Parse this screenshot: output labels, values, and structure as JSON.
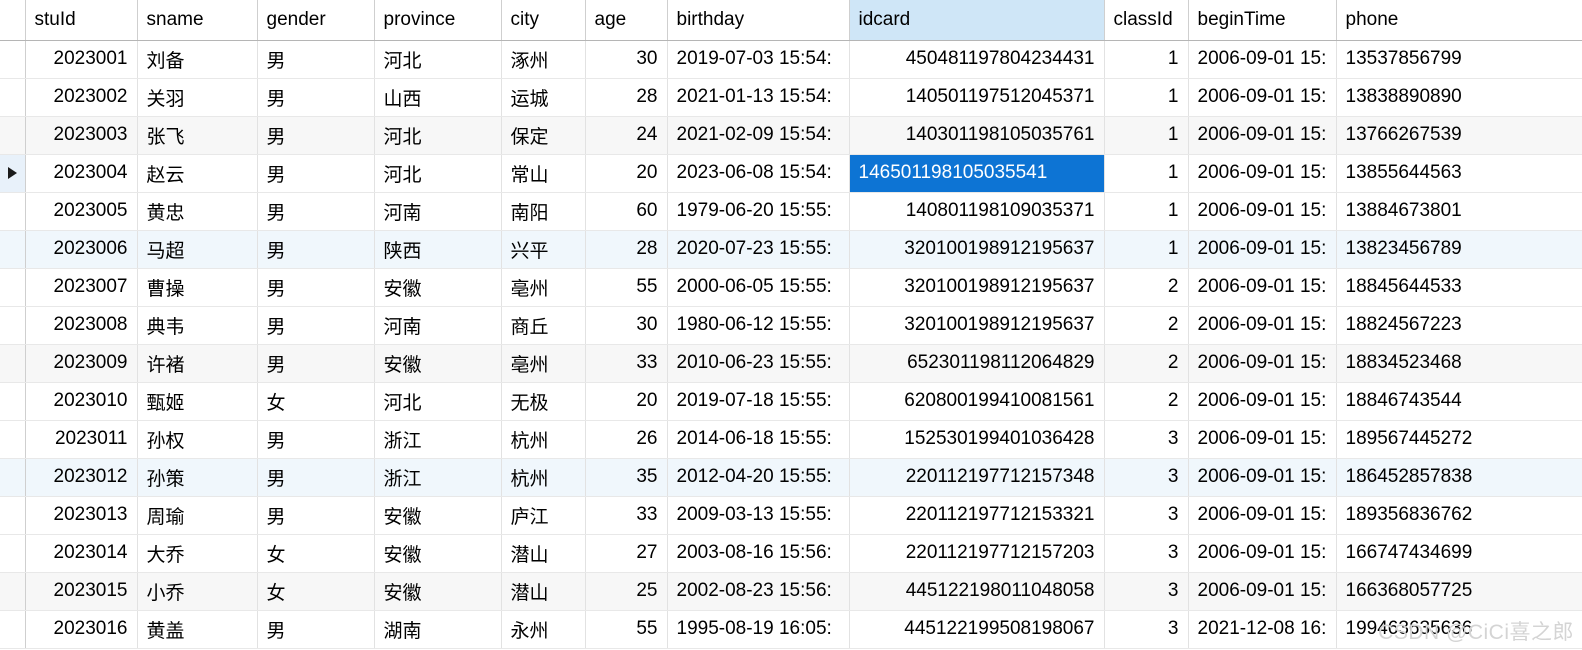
{
  "grid": {
    "row_indicator_symbol": "▶",
    "current_row_index": 3,
    "selected_cell": {
      "row_index": 3,
      "column": "idcard"
    },
    "highlighted_header": "idcard",
    "accent_selection_color": "#0d74d4",
    "header_highlight_color": "#cfe6f7",
    "columns": [
      {
        "key": "stuId",
        "label": "stuId",
        "align": "right"
      },
      {
        "key": "sname",
        "label": "sname",
        "align": "left"
      },
      {
        "key": "gender",
        "label": "gender",
        "align": "left"
      },
      {
        "key": "province",
        "label": "province",
        "align": "left"
      },
      {
        "key": "city",
        "label": "city",
        "align": "left"
      },
      {
        "key": "age",
        "label": "age",
        "align": "right"
      },
      {
        "key": "birthday",
        "label": "birthday",
        "align": "left"
      },
      {
        "key": "idcard",
        "label": "idcard",
        "align": "right"
      },
      {
        "key": "classId",
        "label": "classId",
        "align": "right"
      },
      {
        "key": "beginTime",
        "label": "beginTime",
        "align": "left"
      },
      {
        "key": "phone",
        "label": "phone",
        "align": "left"
      }
    ],
    "rows": [
      {
        "stuId": "2023001",
        "sname": "刘备",
        "gender": "男",
        "province": "河北",
        "city": "涿州",
        "age": "30",
        "birthday": "2019-07-03 15:54:",
        "idcard": "450481197804234431",
        "classId": "1",
        "beginTime": "2006-09-01 15:",
        "phone": "13537856799"
      },
      {
        "stuId": "2023002",
        "sname": "关羽",
        "gender": "男",
        "province": "山西",
        "city": "运城",
        "age": "28",
        "birthday": "2021-01-13 15:54:",
        "idcard": "140501197512045371",
        "classId": "1",
        "beginTime": "2006-09-01 15:",
        "phone": "13838890890"
      },
      {
        "stuId": "2023003",
        "sname": "张飞",
        "gender": "男",
        "province": "河北",
        "city": "保定",
        "age": "24",
        "birthday": "2021-02-09 15:54:",
        "idcard": "140301198105035761",
        "classId": "1",
        "beginTime": "2006-09-01 15:",
        "phone": "13766267539"
      },
      {
        "stuId": "2023004",
        "sname": "赵云",
        "gender": "男",
        "province": "河北",
        "city": "常山",
        "age": "20",
        "birthday": "2023-06-08 15:54:",
        "idcard": "146501198105035541",
        "classId": "1",
        "beginTime": "2006-09-01 15:",
        "phone": "13855644563"
      },
      {
        "stuId": "2023005",
        "sname": "黄忠",
        "gender": "男",
        "province": "河南",
        "city": "南阳",
        "age": "60",
        "birthday": "1979-06-20 15:55:",
        "idcard": "140801198109035371",
        "classId": "1",
        "beginTime": "2006-09-01 15:",
        "phone": "13884673801"
      },
      {
        "stuId": "2023006",
        "sname": "马超",
        "gender": "男",
        "province": "陕西",
        "city": "兴平",
        "age": "28",
        "birthday": "2020-07-23 15:55:",
        "idcard": "320100198912195637",
        "classId": "1",
        "beginTime": "2006-09-01 15:",
        "phone": "13823456789"
      },
      {
        "stuId": "2023007",
        "sname": "曹操",
        "gender": "男",
        "province": "安徽",
        "city": "亳州",
        "age": "55",
        "birthday": "2000-06-05 15:55:",
        "idcard": "320100198912195637",
        "classId": "2",
        "beginTime": "2006-09-01 15:",
        "phone": "18845644533"
      },
      {
        "stuId": "2023008",
        "sname": "典韦",
        "gender": "男",
        "province": "河南",
        "city": "商丘",
        "age": "30",
        "birthday": "1980-06-12 15:55:",
        "idcard": "320100198912195637",
        "classId": "2",
        "beginTime": "2006-09-01 15:",
        "phone": "18824567223"
      },
      {
        "stuId": "2023009",
        "sname": "许褚",
        "gender": "男",
        "province": "安徽",
        "city": "亳州",
        "age": "33",
        "birthday": "2010-06-23 15:55:",
        "idcard": "652301198112064829",
        "classId": "2",
        "beginTime": "2006-09-01 15:",
        "phone": "18834523468"
      },
      {
        "stuId": "2023010",
        "sname": "甄姬",
        "gender": "女",
        "province": "河北",
        "city": "无极",
        "age": "20",
        "birthday": "2019-07-18 15:55:",
        "idcard": "620800199410081561",
        "classId": "2",
        "beginTime": "2006-09-01 15:",
        "phone": "18846743544"
      },
      {
        "stuId": "2023011",
        "sname": "孙权",
        "gender": "男",
        "province": "浙江",
        "city": "杭州",
        "age": "26",
        "birthday": "2014-06-18 15:55:",
        "idcard": "152530199401036428",
        "classId": "3",
        "beginTime": "2006-09-01 15:",
        "phone": "189567445272"
      },
      {
        "stuId": "2023012",
        "sname": "孙策",
        "gender": "男",
        "province": "浙江",
        "city": "杭州",
        "age": "35",
        "birthday": "2012-04-20 15:55:",
        "idcard": "220112197712157348",
        "classId": "3",
        "beginTime": "2006-09-01 15:",
        "phone": "186452857838"
      },
      {
        "stuId": "2023013",
        "sname": "周瑜",
        "gender": "男",
        "province": "安徽",
        "city": "庐江",
        "age": "33",
        "birthday": "2009-03-13 15:55:",
        "idcard": "220112197712153321",
        "classId": "3",
        "beginTime": "2006-09-01 15:",
        "phone": "189356836762"
      },
      {
        "stuId": "2023014",
        "sname": "大乔",
        "gender": "女",
        "province": "安徽",
        "city": "潜山",
        "age": "27",
        "birthday": "2003-08-16 15:56:",
        "idcard": "220112197712157203",
        "classId": "3",
        "beginTime": "2006-09-01 15:",
        "phone": "166747434699"
      },
      {
        "stuId": "2023015",
        "sname": "小乔",
        "gender": "女",
        "province": "安徽",
        "city": "潜山",
        "age": "25",
        "birthday": "2002-08-23 15:56:",
        "idcard": "445122198011048058",
        "classId": "3",
        "beginTime": "2006-09-01 15:",
        "phone": "166368057725"
      },
      {
        "stuId": "2023016",
        "sname": "黄盖",
        "gender": "男",
        "province": "湖南",
        "city": "永州",
        "age": "55",
        "birthday": "1995-08-19 16:05:",
        "idcard": "445122199508198067",
        "classId": "3",
        "beginTime": "2021-12-08 16:",
        "phone": "199463635636"
      }
    ]
  },
  "watermark": {
    "text": "CSDN @CiCi喜之郎"
  }
}
